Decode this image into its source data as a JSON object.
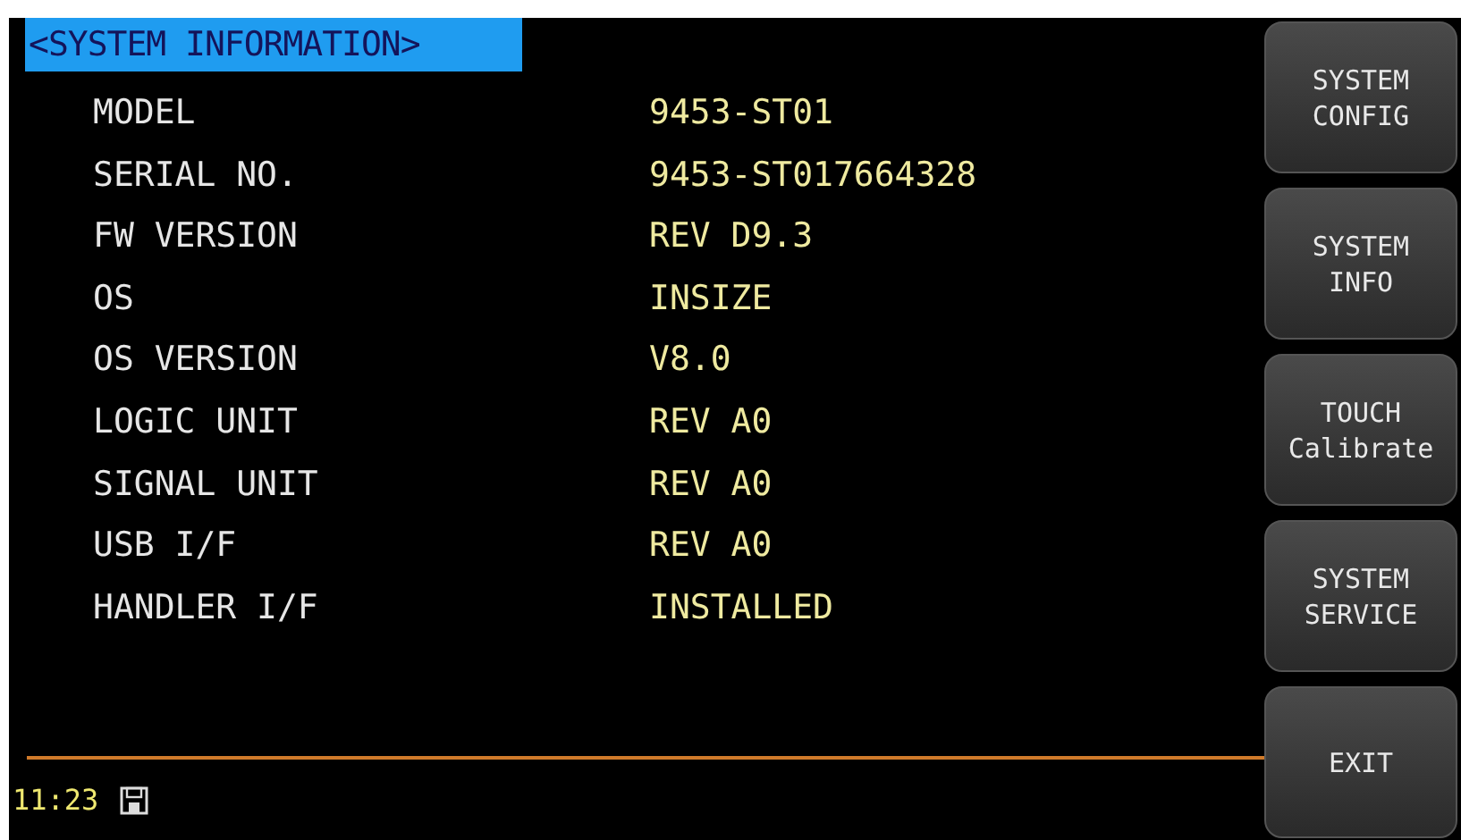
{
  "title": "<SYSTEM INFORMATION>",
  "rows": [
    {
      "label": "MODEL",
      "value": "9453-ST01"
    },
    {
      "label": "SERIAL NO.",
      "value": "9453-ST017664328"
    },
    {
      "label": "FW VERSION",
      "value": "REV D9.3"
    },
    {
      "label": "OS",
      "value": "INSIZE"
    },
    {
      "label": "OS VERSION",
      "value": "V8.0"
    },
    {
      "label": "LOGIC UNIT",
      "value": "REV A0"
    },
    {
      "label": "SIGNAL UNIT",
      "value": "REV A0"
    },
    {
      "label": "USB I/F",
      "value": "REV A0"
    },
    {
      "label": "HANDLER I/F",
      "value": "INSTALLED"
    }
  ],
  "softkeys": [
    {
      "lines": [
        "SYSTEM",
        "CONFIG"
      ]
    },
    {
      "lines": [
        "SYSTEM",
        "INFO"
      ]
    },
    {
      "lines": [
        "TOUCH",
        "Calibrate"
      ]
    },
    {
      "lines": [
        "SYSTEM",
        "SERVICE"
      ]
    },
    {
      "lines": [
        "EXIT"
      ]
    }
  ],
  "status_bar": {
    "time": "11:23",
    "save_icon": true
  }
}
